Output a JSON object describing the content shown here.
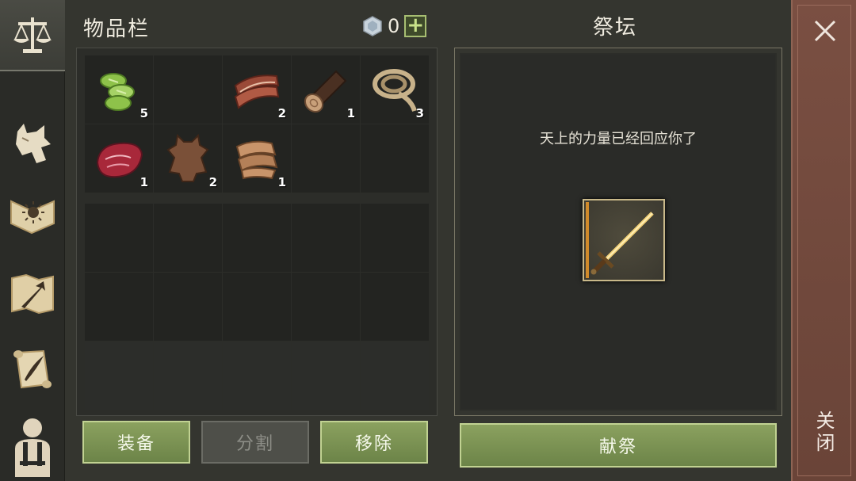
{
  "inventory": {
    "title": "物品栏",
    "currency": {
      "icon": "gem-icon",
      "value": "0",
      "add_label": "+"
    },
    "items": [
      {
        "name": "cucumber-slices",
        "count": "5"
      },
      {
        "name": "empty",
        "count": ""
      },
      {
        "name": "raw-bacon",
        "count": "2"
      },
      {
        "name": "wood-log",
        "count": "1"
      },
      {
        "name": "rope",
        "count": "3"
      },
      {
        "name": "raw-meat",
        "count": "1"
      },
      {
        "name": "animal-hide",
        "count": "2"
      },
      {
        "name": "cloth-scrap",
        "count": "1"
      }
    ],
    "buttons": {
      "equip": "装备",
      "split": "分割",
      "remove": "移除"
    }
  },
  "altar": {
    "title": "祭坛",
    "message": "天上的力量已经回应你了",
    "item": "golden-sword-icon",
    "sacrifice_label": "献祭"
  },
  "sidebar": {
    "tabs": [
      "scales-icon",
      "wolf-icon",
      "sun-book-icon",
      "map-arrow-icon",
      "scroll-quill-icon",
      "character-icon"
    ]
  },
  "close": {
    "label": "关闭"
  },
  "colors": {
    "background": "#34352f",
    "button_green": "#7a9152",
    "close_strip": "#6f473b",
    "altar_slot_border": "#c9b98a"
  }
}
